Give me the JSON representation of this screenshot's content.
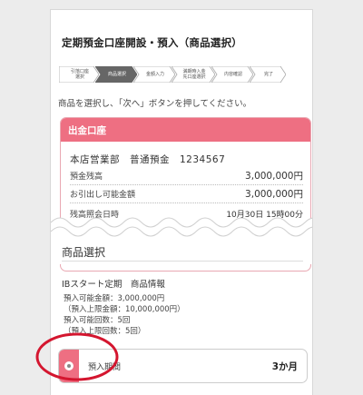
{
  "page": {
    "title": "定期預金口座開設・預入（商品選択）",
    "instruction": "商品を選択し、「次へ」ボタンを押してください。"
  },
  "steps": [
    {
      "label": "引落口座\n選択",
      "active": false
    },
    {
      "label": "商品選択",
      "active": true
    },
    {
      "label": "金額入力",
      "active": false
    },
    {
      "label": "満期時入金\n先口座選択",
      "active": false
    },
    {
      "label": "内容確認",
      "active": false
    },
    {
      "label": "完了",
      "active": false
    }
  ],
  "withdrawal_account": {
    "heading": "出金口座",
    "account_line": "本店営業部　普通預金　1234567",
    "balance_label": "預金残高",
    "balance_value": "3,000,000円",
    "available_label": "お引出し可能金額",
    "available_value": "3,000,000円",
    "cut_label": "残高照会日時",
    "cut_value": "10月30日 15時00分"
  },
  "product_section": {
    "heading": "商品選択",
    "product_name": "IBスタート定期　商品情報",
    "info_lines": [
      "預入可能金額：3,000,000円",
      "（預入上限金額：10,000,000円）",
      "預入可能回数：5回",
      "（預入上限回数：5回）"
    ]
  },
  "term_option": {
    "label": "預入期間",
    "value": "3か月"
  },
  "colors": {
    "accent_pink": "#ee6f82",
    "step_active": "#666666",
    "highlight_ring": "#d4162f"
  }
}
